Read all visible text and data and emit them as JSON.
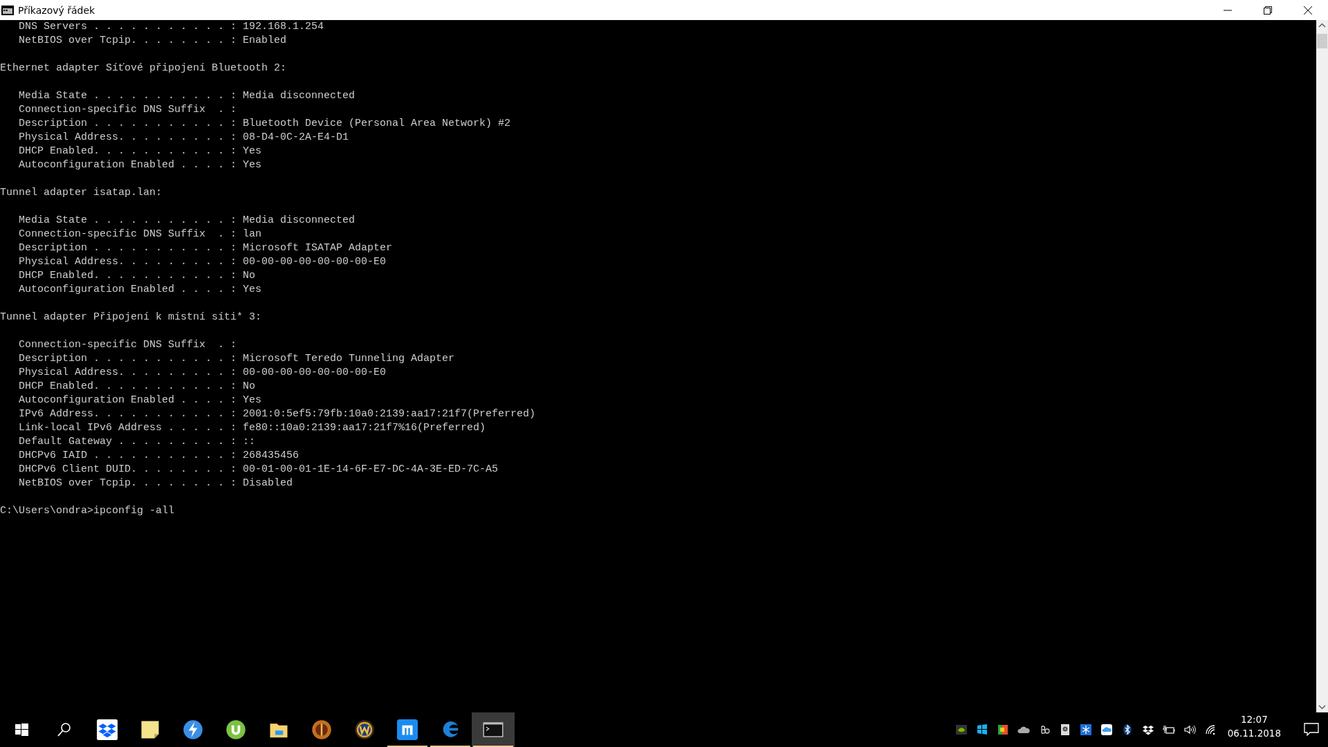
{
  "window": {
    "title": "Příkazový řádek"
  },
  "console": {
    "blocks": [
      [
        "   DNS Servers . . . . . . . . . . . : 192.168.1.254",
        "   NetBIOS over Tcpip. . . . . . . . : Enabled"
      ],
      [
        "Ethernet adapter Síťové připojení Bluetooth 2:"
      ],
      [
        "   Media State . . . . . . . . . . . : Media disconnected",
        "   Connection-specific DNS Suffix  . :",
        "   Description . . . . . . . . . . . : Bluetooth Device (Personal Area Network) #2",
        "   Physical Address. . . . . . . . . : 08-D4-0C-2A-E4-D1",
        "   DHCP Enabled. . . . . . . . . . . : Yes",
        "   Autoconfiguration Enabled . . . . : Yes"
      ],
      [
        "Tunnel adapter isatap.lan:"
      ],
      [
        "   Media State . . . . . . . . . . . : Media disconnected",
        "   Connection-specific DNS Suffix  . : lan",
        "   Description . . . . . . . . . . . : Microsoft ISATAP Adapter",
        "   Physical Address. . . . . . . . . : 00-00-00-00-00-00-00-E0",
        "   DHCP Enabled. . . . . . . . . . . : No",
        "   Autoconfiguration Enabled . . . . : Yes"
      ],
      [
        "Tunnel adapter Připojení k místní síti* 3:"
      ],
      [
        "   Connection-specific DNS Suffix  . :",
        "   Description . . . . . . . . . . . : Microsoft Teredo Tunneling Adapter",
        "   Physical Address. . . . . . . . . : 00-00-00-00-00-00-00-E0",
        "   DHCP Enabled. . . . . . . . . . . : No",
        "   Autoconfiguration Enabled . . . . : Yes",
        "   IPv6 Address. . . . . . . . . . . : 2001:0:5ef5:79fb:10a0:2139:aa17:21f7(Preferred)",
        "   Link-local IPv6 Address . . . . . : fe80::10a0:2139:aa17:21f7%16(Preferred)",
        "   Default Gateway . . . . . . . . . : ::",
        "   DHCPv6 IAID . . . . . . . . . . . : 268435456",
        "   DHCPv6 Client DUID. . . . . . . . : 00-01-00-01-1E-14-6F-E7-DC-4A-3E-ED-7C-A5",
        "   NetBIOS over Tcpip. . . . . . . . : Disabled"
      ],
      [
        "C:\\Users\\ondra>ipconfig -all"
      ]
    ]
  },
  "taskbar": {
    "apps": [
      {
        "kind": "start",
        "running": false,
        "selected": false
      },
      {
        "kind": "search",
        "running": false,
        "selected": false
      },
      {
        "kind": "dropbox",
        "running": false,
        "selected": false
      },
      {
        "kind": "notes",
        "running": false,
        "selected": false
      },
      {
        "kind": "bolt",
        "running": false,
        "selected": false
      },
      {
        "kind": "torrent",
        "running": false,
        "selected": false
      },
      {
        "kind": "folder",
        "running": false,
        "selected": false
      },
      {
        "kind": "emblem",
        "running": false,
        "selected": false
      },
      {
        "kind": "wemblem",
        "running": false,
        "selected": false
      },
      {
        "kind": "maxthon",
        "running": true,
        "selected": false
      },
      {
        "kind": "edge",
        "running": true,
        "selected": false
      },
      {
        "kind": "terminal",
        "running": true,
        "selected": true
      }
    ],
    "tray": [
      {
        "kind": "gpu"
      },
      {
        "kind": "windows"
      },
      {
        "kind": "shield"
      },
      {
        "kind": "cloud"
      },
      {
        "kind": "bo"
      },
      {
        "kind": "disk"
      },
      {
        "kind": "snow"
      },
      {
        "kind": "bluecloud"
      },
      {
        "kind": "bluetooth"
      },
      {
        "kind": "dropbox"
      },
      {
        "kind": "battery"
      },
      {
        "kind": "volume"
      },
      {
        "kind": "wifi"
      }
    ],
    "time": "12:07",
    "date": "06.11.2018"
  }
}
